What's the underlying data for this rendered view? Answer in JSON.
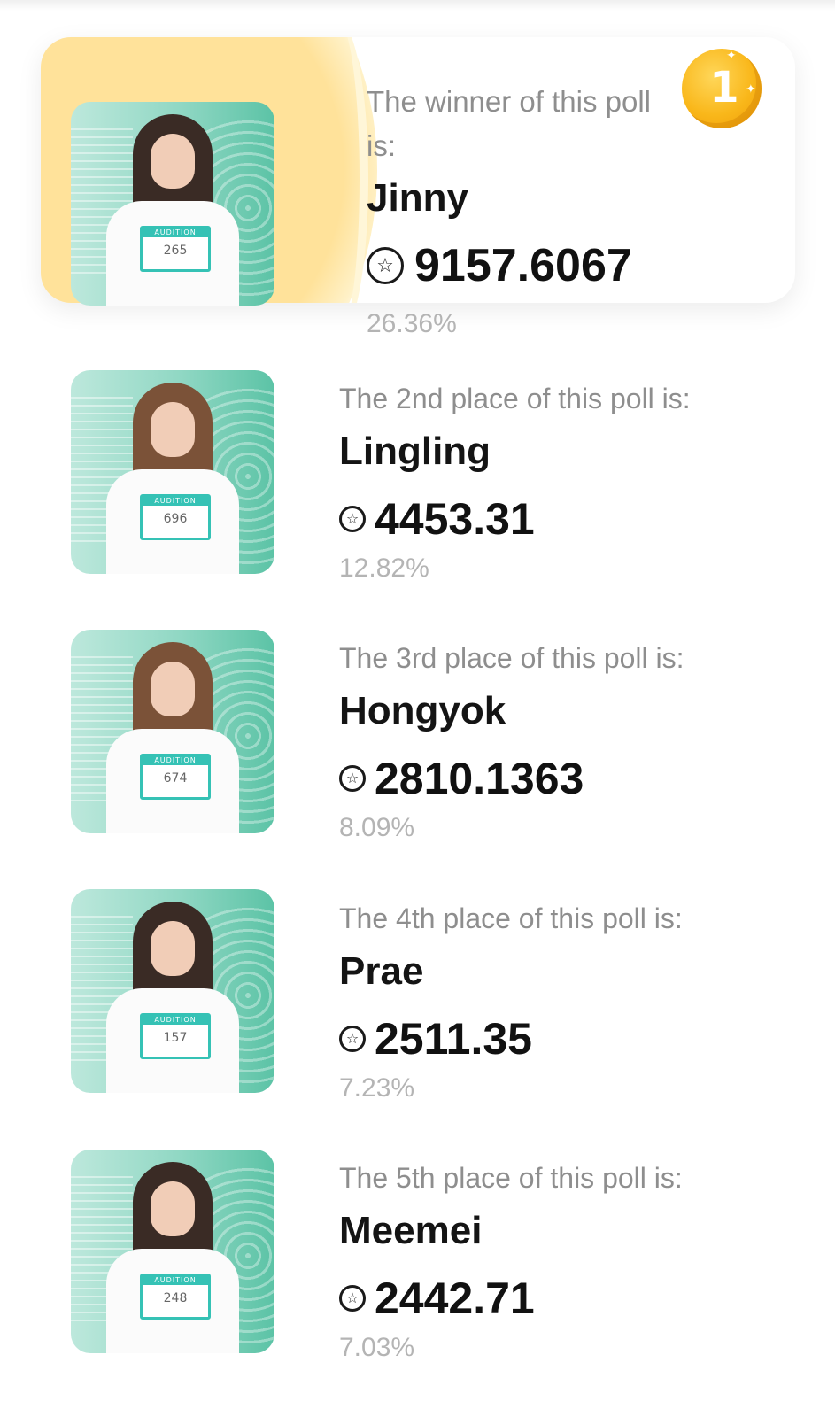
{
  "medal": {
    "number": "1"
  },
  "entries": [
    {
      "place_text": "The winner of this poll is:",
      "name": "Jinny",
      "score": "9157.6067",
      "percent": "26.36%",
      "tag_label": "AUDITION",
      "tag_number": "265"
    },
    {
      "place_text": "The 2nd place of this poll is:",
      "name": "Lingling",
      "score": "4453.31",
      "percent": "12.82%",
      "tag_label": "AUDITION",
      "tag_number": "696"
    },
    {
      "place_text": "The 3rd place of this poll is:",
      "name": "Hongyok",
      "score": "2810.1363",
      "percent": "8.09%",
      "tag_label": "AUDITION",
      "tag_number": "674"
    },
    {
      "place_text": "The 4th place of this poll is:",
      "name": "Prae",
      "score": "2511.35",
      "percent": "7.23%",
      "tag_label": "AUDITION",
      "tag_number": "157"
    },
    {
      "place_text": "The 5th place of this poll is:",
      "name": "Meemei",
      "score": "2442.71",
      "percent": "7.03%",
      "tag_label": "AUDITION",
      "tag_number": "248"
    }
  ],
  "icons": {
    "score_icon": "star-coin-icon",
    "medal_icon": "gold-medal-icon"
  },
  "colors": {
    "accent": "#f9b71a",
    "photo_bg": "#8fd7c3",
    "winner_glow": "#ffe29a",
    "muted_text": "#8e8e8e"
  }
}
